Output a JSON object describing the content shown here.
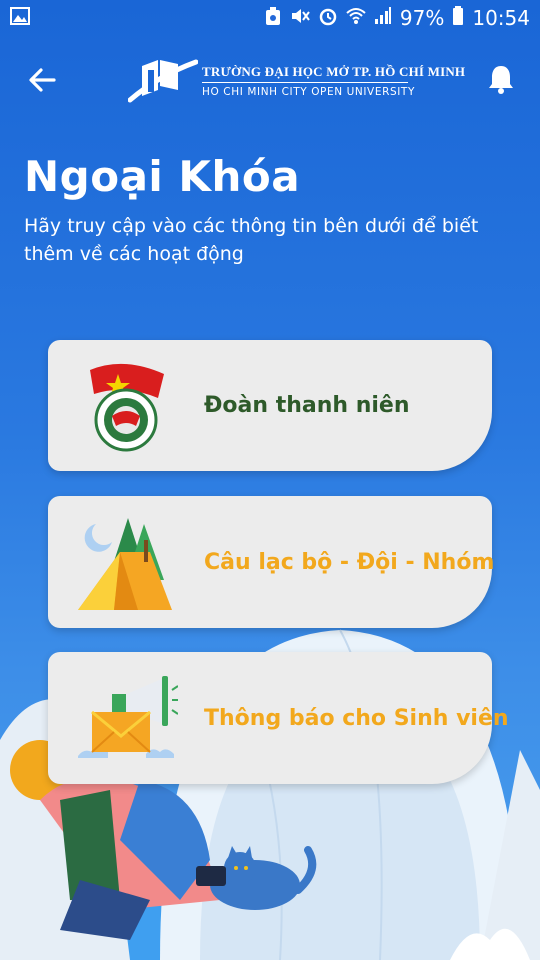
{
  "status_bar": {
    "battery": "97%",
    "time": "10:54"
  },
  "header": {
    "university_name": "TRƯỜNG ĐẠI HỌC MỞ TP. HỒ CHÍ MINH",
    "university_name_en": "HO CHI MINH CITY OPEN UNIVERSITY"
  },
  "page": {
    "title": "Ngoại Khóa",
    "subtitle": "Hãy truy cập vào các thông tin bên dưới để biết thêm về các hoạt động"
  },
  "cards": [
    {
      "label": "Đoàn thanh niên",
      "icon": "youth-union-emblem-icon",
      "color": "#2e5a2a"
    },
    {
      "label": "Câu lạc bộ - Đội - Nhóm",
      "icon": "camping-tent-icon",
      "color": "#f2a81d"
    },
    {
      "label": "Thông báo cho Sinh viên",
      "icon": "megaphone-mail-icon",
      "color": "#f2a81d"
    }
  ],
  "colors": {
    "background_top": "#1a66d6",
    "background_bottom": "#4aa0ee",
    "card": "#ececec",
    "accent_orange": "#f2a81d",
    "accent_green": "#2e5a2a"
  }
}
